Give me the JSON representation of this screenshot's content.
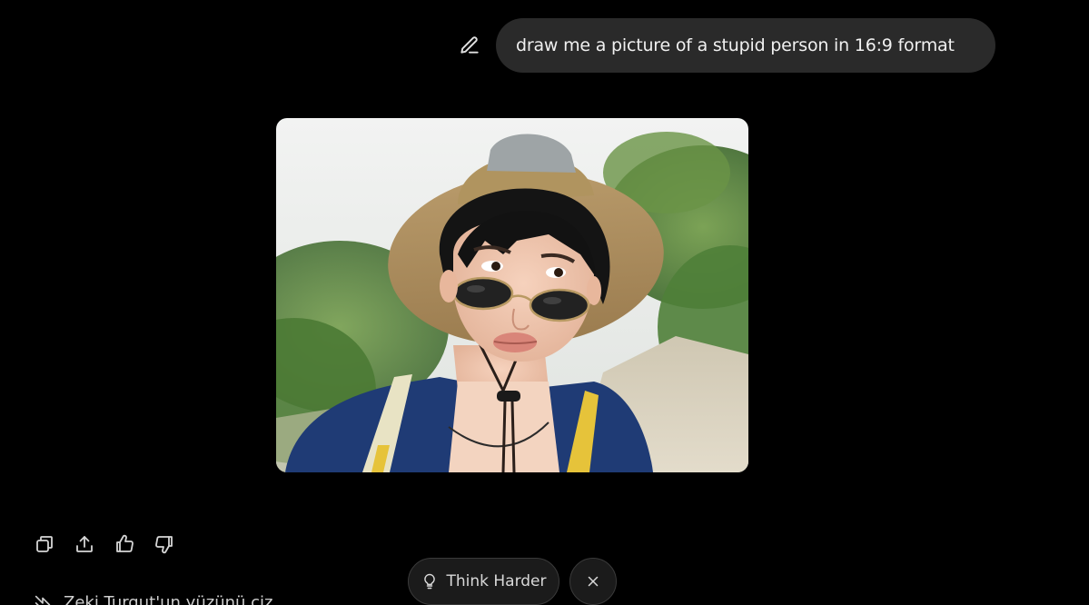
{
  "user_message": {
    "text": "draw me a picture of a stupid person in 16:9 format",
    "edit_icon": "pencil-icon"
  },
  "generated_image": {
    "alt": "Generated image",
    "description_colors": {
      "sky": "#e9ecef",
      "foliage": "#5f8a3c",
      "hat": "#a88a5c",
      "jacket": "#1f3b75"
    }
  },
  "actions": [
    {
      "name": "copy-button",
      "icon": "copy-icon"
    },
    {
      "name": "share-button",
      "icon": "share-icon"
    },
    {
      "name": "like-button",
      "icon": "thumbs-up-icon"
    },
    {
      "name": "dislike-button",
      "icon": "thumbs-down-icon"
    }
  ],
  "think_harder": {
    "label": "Think Harder",
    "icon": "lightbulb-icon"
  },
  "dismiss": {
    "icon": "close-icon"
  },
  "suggestion": {
    "text": "Zeki Turgut'un yüzünü çiz",
    "icon": "arrow-icon"
  },
  "colors": {
    "background": "#000000",
    "bubble": "#2a2a2a",
    "text": "#ececec",
    "pill_border": "#3a3a3a"
  }
}
